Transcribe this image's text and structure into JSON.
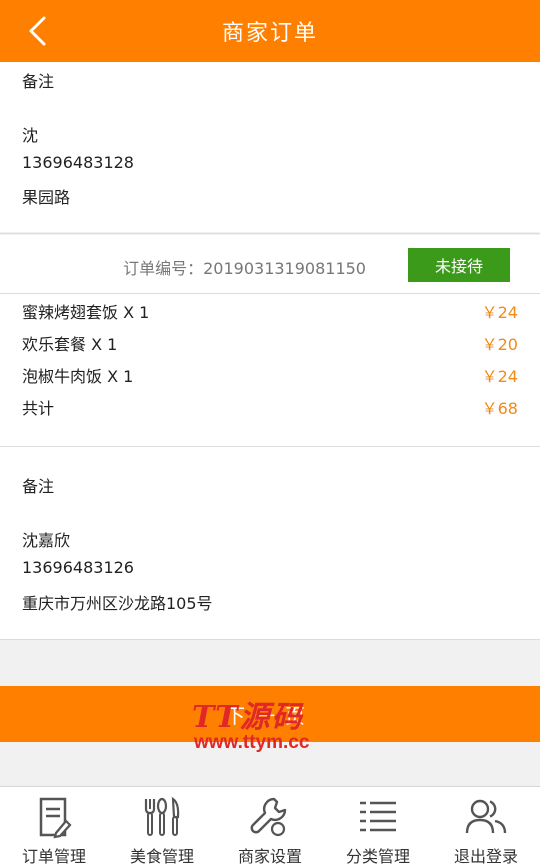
{
  "header": {
    "title": "商家订单"
  },
  "order1": {
    "remark_label": "备注",
    "customer_name": "沈",
    "phone": "13696483128",
    "address": "果园路"
  },
  "order2": {
    "order_no": "订单编号：2019031319081150",
    "status": "未接待",
    "items": [
      {
        "name": "蜜辣烤翅套饭 X 1",
        "price": "￥24"
      },
      {
        "name": "欢乐套餐 X 1",
        "price": "￥20"
      },
      {
        "name": "泡椒牛肉饭 X 1",
        "price": "￥24"
      }
    ],
    "total_label": "共计",
    "total_price": "￥68",
    "remark_label": "备注",
    "customer_name": "沈嘉欣",
    "phone": "13696483126",
    "address": "重庆市万州区沙龙路105号"
  },
  "bar": {
    "label": "下一页"
  },
  "watermark": {
    "brand": "TT源码",
    "url": "www.ttym.cc"
  },
  "tabbar": {
    "items": [
      {
        "label": "订单管理",
        "icon": "order-doc-icon"
      },
      {
        "label": "美食管理",
        "icon": "cutlery-icon"
      },
      {
        "label": "商家设置",
        "icon": "wrench-icon"
      },
      {
        "label": "分类管理",
        "icon": "list-icon"
      },
      {
        "label": "退出登录",
        "icon": "users-icon"
      }
    ]
  },
  "colors": {
    "brand": "#ff7f00",
    "status_green": "#3c9a1a",
    "price": "#f08a1a"
  }
}
